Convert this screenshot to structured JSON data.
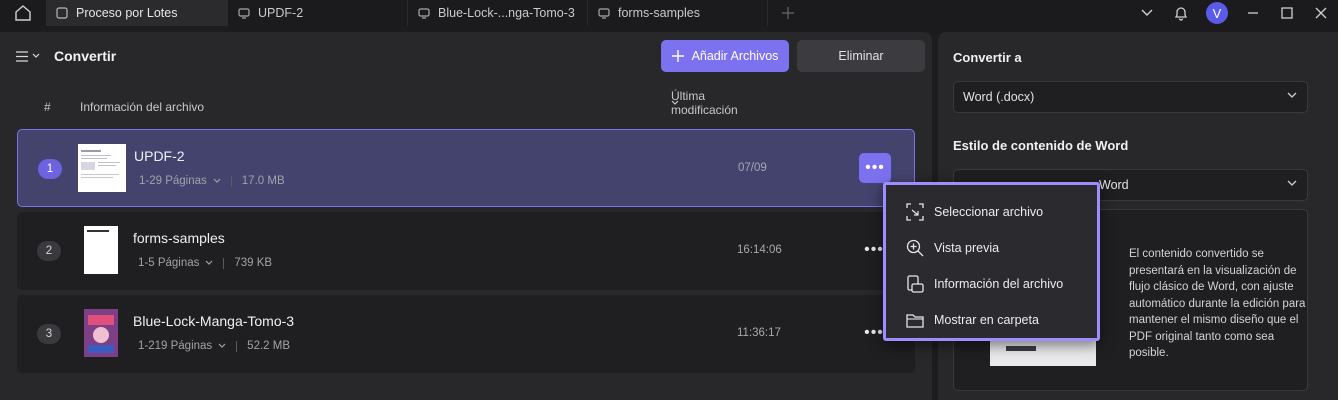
{
  "tabs": [
    {
      "label": "Proceso por Lotes",
      "active": true
    },
    {
      "label": "UPDF-2",
      "active": false
    },
    {
      "label": "Blue-Lock-...nga-Tomo-3",
      "active": false
    },
    {
      "label": "forms-samples",
      "active": false
    }
  ],
  "window": {
    "avatar_letter": "V"
  },
  "header": {
    "title": "Convertir",
    "add_label": "Añadir Archivos",
    "delete_label": "Eliminar"
  },
  "columns": {
    "num": "#",
    "info": "Información del archivo",
    "modified": "Última modificación"
  },
  "files": [
    {
      "index": "1",
      "name": "UPDF-2",
      "pages": "1-29 Páginas",
      "size": "17.0 MB",
      "date": "07/09"
    },
    {
      "index": "2",
      "name": "forms-samples",
      "pages": "1-5 Páginas",
      "size": "739 KB",
      "date": "16:14:06"
    },
    {
      "index": "3",
      "name": "Blue-Lock-Manga-Tomo-3",
      "pages": "1-219 Páginas",
      "size": "52.2 MB",
      "date": "11:36:17"
    }
  ],
  "context_menu": {
    "items": [
      "Seleccionar archivo",
      "Vista previa",
      "Información del archivo",
      "Mostrar en carpeta"
    ]
  },
  "right": {
    "convert_label": "Convertir a",
    "format_value": "Word (.docx)",
    "style_label": "Estilo de contenido de Word",
    "style_value_partial": "Word",
    "description": "El contenido convertido se presentará en la visualización de flujo clásico de Word, con ajuste automático durante la edición para mantener el mismo diseño que el PDF original tanto como sea posible."
  },
  "colors": {
    "accent": "#7c72f0",
    "selected_row": "#43436e",
    "menu_border": "#9d8dff"
  }
}
